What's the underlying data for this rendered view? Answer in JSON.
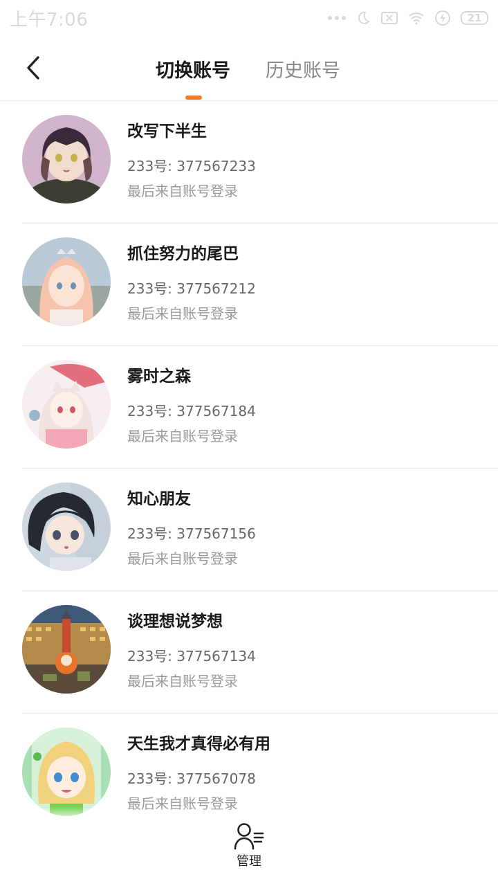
{
  "status_bar": {
    "time": "上午7:06",
    "battery": "21"
  },
  "header": {
    "tabs": [
      {
        "label": "切换账号",
        "active": true
      },
      {
        "label": "历史账号",
        "active": false
      }
    ],
    "accent_color": "#f57a24"
  },
  "accounts": [
    {
      "name": "改写下半生",
      "id_text": "233号: 377567233",
      "last_login": "最后来自账号登录",
      "avatar_bg": "#c9a9c2"
    },
    {
      "name": "抓住努力的尾巴",
      "id_text": "233号: 377567212",
      "last_login": "最后来自账号登录",
      "avatar_bg": "#f3c9b8"
    },
    {
      "name": "雾时之森",
      "id_text": "233号: 377567184",
      "last_login": "最后来自账号登录",
      "avatar_bg": "#f4cfd6"
    },
    {
      "name": "知心朋友",
      "id_text": "233号: 377567156",
      "last_login": "最后来自账号登录",
      "avatar_bg": "#c8d2dc"
    },
    {
      "name": "谈理想说梦想",
      "id_text": "233号: 377567134",
      "last_login": "最后来自账号登录",
      "avatar_bg": "#6a5a4a"
    },
    {
      "name": "天生我才真得必有用",
      "id_text": "233号: 377567078",
      "last_login": "最后来自账号登录",
      "avatar_bg": "#bfe6c8"
    }
  ],
  "footer": {
    "manage_label": "管理",
    "manage_icon": "user-manage-icon"
  }
}
